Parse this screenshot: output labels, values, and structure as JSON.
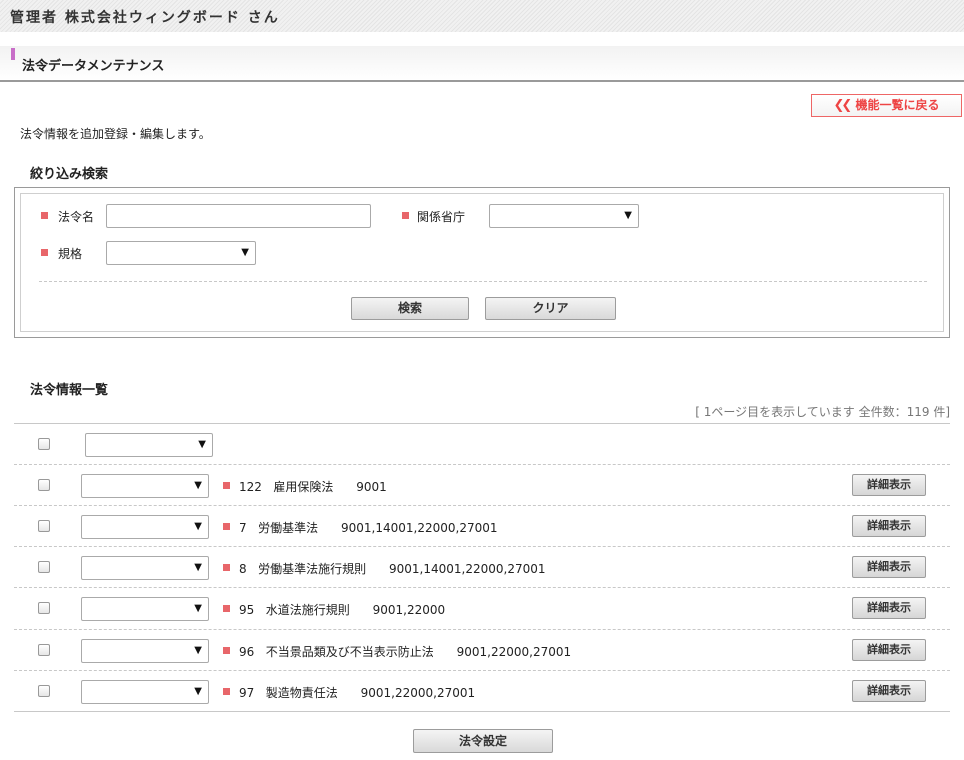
{
  "header": {
    "admin_label": "管理者 株式会社ウィングボード さん"
  },
  "page": {
    "title": "法令データメンテナンス",
    "back_label": "機能一覧に戻る",
    "description": "法令情報を追加登録・編集します。"
  },
  "filter": {
    "title": "絞り込み検索",
    "law_name_label": "法令名",
    "law_name_value": "",
    "ministry_label": "関係省庁",
    "ministry_value": "",
    "standard_label": "規格",
    "standard_value": "",
    "search_label": "検索",
    "clear_label": "クリア"
  },
  "list": {
    "title": "法令情報一覧",
    "count_text": "[ 1ページ目を表示しています 全件数：119 件]",
    "bulk_select_value": "",
    "detail_label": "詳細表示",
    "rows": [
      {
        "id": "122",
        "name": "雇用保険法",
        "standards": "9001"
      },
      {
        "id": "7",
        "name": "労働基準法",
        "standards": "9001,14001,22000,27001"
      },
      {
        "id": "8",
        "name": "労働基準法施行規則",
        "standards": "9001,14001,22000,27001"
      },
      {
        "id": "95",
        "name": "水道法施行規則",
        "standards": "9001,22000"
      },
      {
        "id": "96",
        "name": "不当景品類及び不当表示防止法",
        "standards": "9001,22000,27001"
      },
      {
        "id": "97",
        "name": "製造物責任法",
        "standards": "9001,22000,27001"
      }
    ],
    "submit_label": "法令設定"
  },
  "colors": {
    "accent_red": "#e8666a",
    "title_mark": "#c86ec8"
  },
  "icons": {
    "back": "double-chevron-left-icon",
    "select_arrow": "triangle-down-icon"
  }
}
